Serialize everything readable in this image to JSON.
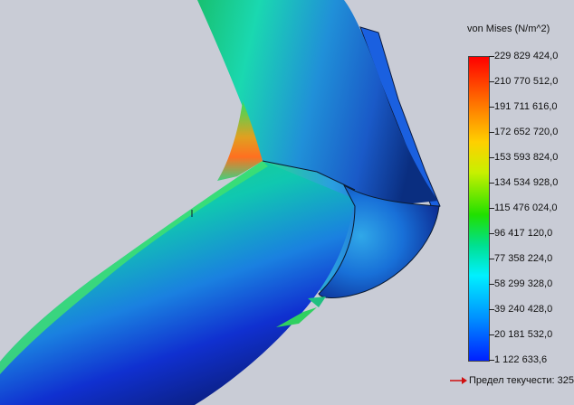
{
  "legend": {
    "title": "von Mises (N/m^2)",
    "ticks": [
      "229 829 424,0",
      "210 770 512,0",
      "191 711 616,0",
      "172 652 720,0",
      "153 593 824,0",
      "134 534 928,0",
      "115 476 024,0",
      "96 417 120,0",
      "77 358 224,0",
      "58 299 328,0",
      "39 240 428,0",
      "20 181 532,0",
      "1 122 633,6"
    ],
    "colors": {
      "max": "#ff0000",
      "high": "#ffd000",
      "mid": "#20e000",
      "low": "#00f0ff",
      "min": "#0020ff"
    }
  },
  "yield": {
    "label": "Предел текучести: 325"
  },
  "viewport": {
    "background": "#c9ccd6"
  }
}
